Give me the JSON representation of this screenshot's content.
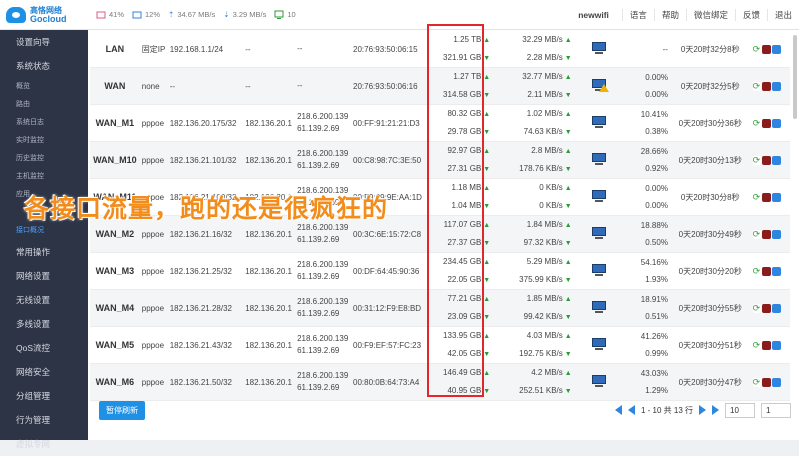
{
  "brand": {
    "cn": "高恪网络",
    "en": "Gocloud"
  },
  "topbar": {
    "cpu": "41%",
    "mem": "12%",
    "up": "34.67 MB/s",
    "down": "3.29 MB/s",
    "conn": "10",
    "device": "newwifi",
    "language": "语言",
    "help": "帮助",
    "wechat": "微信绑定",
    "feedback": "反馈",
    "logout": "退出"
  },
  "sidebar": {
    "top1": "设置向导",
    "top2": "系统状态",
    "sub": [
      "概览",
      "路由",
      "系统日志",
      "实时监控",
      "历史监控",
      "主机监控",
      "应用",
      "",
      "接口概况"
    ],
    "bottom": [
      "常用操作",
      "网络设置",
      "无线设置",
      "多线设置",
      "QoS流控",
      "网络安全",
      "分组管理",
      "行为管理",
      "虚拟专网"
    ]
  },
  "rows": [
    {
      "name": "LAN",
      "mode": "固定IP",
      "ip": "192.168.1.1/24",
      "gw": "--",
      "dns1": "--",
      "dns2": "",
      "mac": "20:76:93:50:06:15",
      "up": "1.25 TB",
      "down": "321.91 GB",
      "rate_up": "32.29 MB/s",
      "rate_down": "2.28 MB/s",
      "warn": false,
      "p1": "--",
      "p2": "",
      "uptime": "0天20时32分8秒"
    },
    {
      "name": "WAN",
      "mode": "none",
      "ip": "--",
      "gw": "--",
      "dns1": "--",
      "dns2": "",
      "mac": "20:76:93:50:06:16",
      "up": "1.27 TB",
      "down": "314.58 GB",
      "rate_up": "32.77 MB/s",
      "rate_down": "2.11 MB/s",
      "warn": true,
      "p1": "0.00%",
      "p2": "0.00%",
      "uptime": "0天20时32分5秒"
    },
    {
      "name": "WAN_M1",
      "mode": "pppoe",
      "ip": "182.136.20.175/32",
      "gw": "182.136.20.1",
      "dns1": "218.6.200.139",
      "dns2": "61.139.2.69",
      "mac": "00:FF:91:21:21:D3",
      "up": "80.32 GB",
      "down": "29.78 GB",
      "rate_up": "1.02 MB/s",
      "rate_down": "74.63 KB/s",
      "warn": false,
      "p1": "10.41%",
      "p2": "0.38%",
      "uptime": "0天20时30分36秒"
    },
    {
      "name": "WAN_M10",
      "mode": "pppoe",
      "ip": "182.136.21.101/32",
      "gw": "182.136.20.1",
      "dns1": "218.6.200.139",
      "dns2": "61.139.2.69",
      "mac": "00:C8:98:7C:3E:50",
      "up": "92.97 GB",
      "down": "27.31 GB",
      "rate_up": "2.8 MB/s",
      "rate_down": "178.76 KB/s",
      "warn": false,
      "p1": "28.66%",
      "p2": "0.92%",
      "uptime": "0天20时30分13秒"
    },
    {
      "name": "WAN_M11",
      "mode": "pppoe",
      "ip": "182.136.21.109/32",
      "gw": "182.136.20.1",
      "dns1": "218.6.200.139",
      "dns2": "61.139.2.69",
      "mac": "00:F9:09:9E:AA:1D",
      "up": "1.18 MB",
      "down": "1.04 MB",
      "rate_up": "0 KB/s",
      "rate_down": "0 KB/s",
      "warn": false,
      "p1": "0.00%",
      "p2": "0.00%",
      "uptime": "0天20时30分8秒"
    },
    {
      "name": "WAN_M2",
      "mode": "pppoe",
      "ip": "182.136.21.16/32",
      "gw": "182.136.20.1",
      "dns1": "218.6.200.139",
      "dns2": "61.139.2.69",
      "mac": "00:3C:6E:15:72:C8",
      "up": "117.07 GB",
      "down": "27.37 GB",
      "rate_up": "1.84 MB/s",
      "rate_down": "97.32 KB/s",
      "warn": false,
      "p1": "18.88%",
      "p2": "0.50%",
      "uptime": "0天20时30分49秒"
    },
    {
      "name": "WAN_M3",
      "mode": "pppoe",
      "ip": "182.136.21.25/32",
      "gw": "182.136.20.1",
      "dns1": "218.6.200.139",
      "dns2": "61.139.2.69",
      "mac": "00:DF:64:45:90:36",
      "up": "234.45 GB",
      "down": "22.05 GB",
      "rate_up": "5.29 MB/s",
      "rate_down": "375.99 KB/s",
      "warn": false,
      "p1": "54.16%",
      "p2": "1.93%",
      "uptime": "0天20时30分20秒"
    },
    {
      "name": "WAN_M4",
      "mode": "pppoe",
      "ip": "182.136.21.28/32",
      "gw": "182.136.20.1",
      "dns1": "218.6.200.139",
      "dns2": "61.139.2.69",
      "mac": "00:31:12:F9:E8:BD",
      "up": "77.21 GB",
      "down": "23.09 GB",
      "rate_up": "1.85 MB/s",
      "rate_down": "99.42 KB/s",
      "warn": false,
      "p1": "18.91%",
      "p2": "0.51%",
      "uptime": "0天20时30分55秒"
    },
    {
      "name": "WAN_M5",
      "mode": "pppoe",
      "ip": "182.136.21.43/32",
      "gw": "182.136.20.1",
      "dns1": "218.6.200.139",
      "dns2": "61.139.2.69",
      "mac": "00:F9:EF:57:FC:23",
      "up": "133.95 GB",
      "down": "42.05 GB",
      "rate_up": "4.03 MB/s",
      "rate_down": "192.75 KB/s",
      "warn": false,
      "p1": "41.26%",
      "p2": "0.99%",
      "uptime": "0天20时30分51秒"
    },
    {
      "name": "WAN_M6",
      "mode": "pppoe",
      "ip": "182.136.21.50/32",
      "gw": "182.136.20.1",
      "dns1": "218.6.200.139",
      "dns2": "61.139.2.69",
      "mac": "00:80:0B:64:73:A4",
      "up": "146.49 GB",
      "down": "40.95 GB",
      "rate_up": "4.2 MB/s",
      "rate_down": "252.51 KB/s",
      "warn": false,
      "p1": "43.03%",
      "p2": "1.29%",
      "uptime": "0天20时30分47秒"
    }
  ],
  "overlay_text": "各接口流量，跑的还是很疯狂的",
  "footer": {
    "refresh": "暂停刷新",
    "page_info": "1 - 10 共 13 行",
    "page_size": "10",
    "page_num": "1"
  },
  "colors": {
    "accent": "#1e90e6",
    "highlight": "#e2262c",
    "overlay": "#f28c1b",
    "sidebar": "#2d3446"
  }
}
